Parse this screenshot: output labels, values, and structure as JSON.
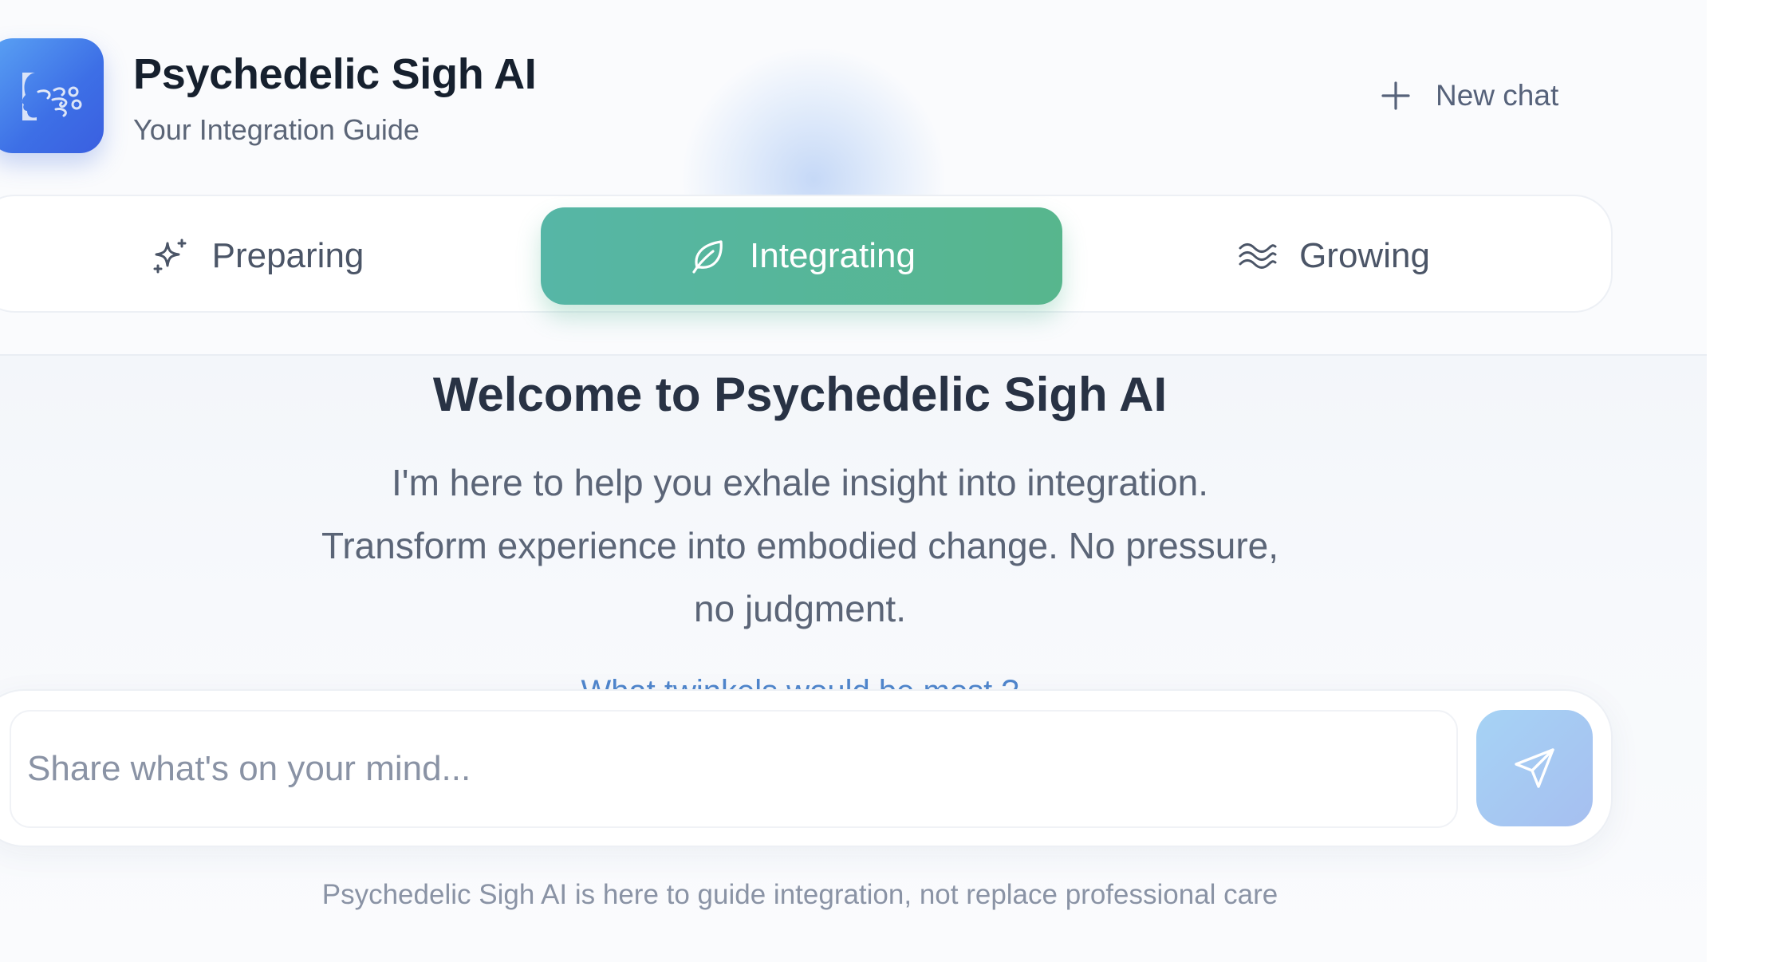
{
  "header": {
    "title": "Psychedelic Sigh AI",
    "subtitle": "Your Integration Guide",
    "logo_icon": "face-exhale-icon",
    "new_chat_label": "New chat"
  },
  "tabs": [
    {
      "label": "Preparing",
      "icon": "sparkle-icon",
      "active": false
    },
    {
      "label": "Integrating",
      "icon": "leaf-icon",
      "active": true
    },
    {
      "label": "Growing",
      "icon": "waves-icon",
      "active": false
    }
  ],
  "welcome": {
    "title": "Welcome to Psychedelic Sigh AI",
    "lines": [
      "I'm here to help you exhale insight into integration.",
      "Transform experience into embodied change. No pressure,",
      "no judgment."
    ],
    "partial_question": "What twinkels would be most ?"
  },
  "composer": {
    "placeholder": "Share what's on your mind...",
    "value": "",
    "send_icon": "send-icon"
  },
  "footer": {
    "disclaimer": "Psychedelic Sigh AI is here to guide integration, not replace professional care"
  },
  "colors": {
    "accent_green": "#57b69a",
    "logo_blue": "#3d6fe6",
    "send_button": "#a6c9f2",
    "title_text": "#16202e",
    "muted_text": "#5b6577"
  }
}
